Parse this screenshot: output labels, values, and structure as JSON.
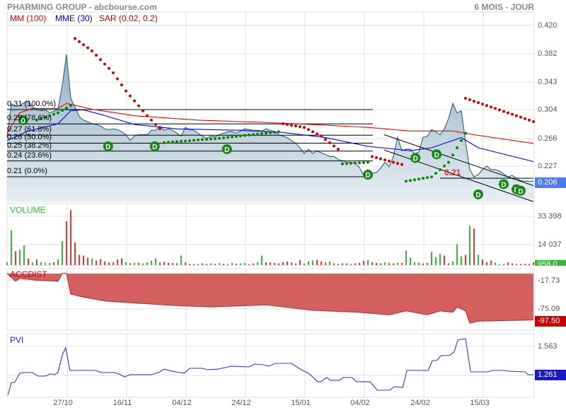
{
  "header": {
    "title": "PHARMING GROUP - abcbourse.com",
    "period": "6 MOIS - JOUR"
  },
  "legend": {
    "mm": "MM (100)",
    "mme": "MME (30)",
    "sar": "SAR (0.02, 0.2)"
  },
  "colors": {
    "mm": "#ee0000",
    "mme": "#0000ee",
    "sar_down": "#cc0000",
    "sar_up": "#008800",
    "area_stroke": "#3d6a80",
    "vol_up": "#33bb33",
    "vol_down": "#ee3333",
    "accdist": "#d66060",
    "pvi": "#3333cc",
    "last_price_badge": "#4a7cf5",
    "vol_badge": "#33bb33",
    "accdist_badge": "#cc0000",
    "pvi_badge": "#1a1acc"
  },
  "chart_data": [
    {
      "type": "line",
      "name": "price",
      "title": "PHARMING GROUP",
      "x_unit": "trading day index",
      "ylim": [
        0.185,
        0.43
      ],
      "y_ticks": [
        "0.420",
        "0.382",
        "0.343",
        "0.304",
        "0.266",
        "0.227"
      ],
      "x_ticks": [
        "27/10",
        "16/11",
        "04/12",
        "24/12",
        "15/01",
        "04/02",
        "24/02",
        "15/03"
      ],
      "last_value": "0.206",
      "close": [
        0.266,
        0.312,
        0.309,
        0.31,
        0.314,
        0.316,
        0.308,
        0.305,
        0.303,
        0.304,
        0.3,
        0.302,
        0.305,
        0.338,
        0.38,
        0.32,
        0.308,
        0.295,
        0.29,
        0.288,
        0.285,
        0.284,
        0.282,
        0.278,
        0.277,
        0.278,
        0.277,
        0.274,
        0.27,
        0.262,
        0.268,
        0.27,
        0.27,
        0.27,
        0.276,
        0.276,
        0.282,
        0.276,
        0.278,
        0.276,
        0.272,
        0.268,
        0.28,
        0.277,
        0.276,
        0.272,
        0.268,
        0.265,
        0.268,
        0.267,
        0.27,
        0.272,
        0.274,
        0.274,
        0.272,
        0.275,
        0.278,
        0.277,
        0.276,
        0.276,
        0.275,
        0.278,
        0.276,
        0.274,
        0.27,
        0.268,
        0.266,
        0.262,
        0.258,
        0.252,
        0.244,
        0.25,
        0.244,
        0.248,
        0.245,
        0.243,
        0.24,
        0.24,
        0.236,
        0.234,
        0.232,
        0.232,
        0.231,
        0.225,
        0.214,
        0.222,
        0.217,
        0.218,
        0.224,
        0.232,
        0.226,
        0.24,
        0.266,
        0.248,
        0.25,
        0.25,
        0.244,
        0.246,
        0.266,
        0.268,
        0.277,
        0.274,
        0.27,
        0.278,
        0.292,
        0.313,
        0.3,
        0.303,
        0.26,
        0.222,
        0.212,
        0.215,
        0.222,
        0.227,
        0.222,
        0.222,
        0.22,
        0.216,
        0.212,
        0.214,
        0.21,
        0.207,
        0.206,
        0.206,
        0.206
      ],
      "mm100": [
        [
          0,
          0.272
        ],
        [
          3,
          0.3
        ],
        [
          6,
          0.306
        ],
        [
          12,
          0.306
        ],
        [
          14,
          0.313
        ],
        [
          20,
          0.305
        ],
        [
          30,
          0.296
        ],
        [
          45,
          0.29
        ],
        [
          60,
          0.287
        ],
        [
          75,
          0.283
        ],
        [
          85,
          0.28
        ],
        [
          95,
          0.275
        ],
        [
          105,
          0.275
        ],
        [
          110,
          0.27
        ],
        [
          124,
          0.258
        ]
      ],
      "mme30": [
        [
          0,
          0.262
        ],
        [
          5,
          0.275
        ],
        [
          12,
          0.285
        ],
        [
          15,
          0.303
        ],
        [
          18,
          0.304
        ],
        [
          22,
          0.298
        ],
        [
          30,
          0.284
        ],
        [
          40,
          0.278
        ],
        [
          55,
          0.276
        ],
        [
          65,
          0.273
        ],
        [
          75,
          0.266
        ],
        [
          85,
          0.254
        ],
        [
          95,
          0.248
        ],
        [
          100,
          0.252
        ],
        [
          107,
          0.266
        ],
        [
          111,
          0.252
        ],
        [
          124,
          0.233
        ]
      ],
      "sar": [
        {
          "trend": "down",
          "points": [
            [
              16,
              0.402
            ],
            [
              20,
              0.385
            ],
            [
              25,
              0.355
            ],
            [
              28,
              0.33
            ],
            [
              33,
              0.296
            ],
            [
              36,
              0.278
            ]
          ]
        },
        {
          "trend": "up",
          "points": [
            [
              7,
              0.29
            ],
            [
              12,
              0.3
            ],
            [
              15,
              0.31
            ]
          ]
        },
        {
          "trend": "up",
          "points": [
            [
              37,
              0.259
            ],
            [
              50,
              0.265
            ],
            [
              64,
              0.274
            ]
          ]
        },
        {
          "trend": "down",
          "points": [
            [
              65,
              0.285
            ],
            [
              70,
              0.28
            ],
            [
              74,
              0.268
            ],
            [
              78,
              0.25
            ]
          ]
        },
        {
          "trend": "up",
          "points": [
            [
              79,
              0.23
            ],
            [
              85,
              0.232
            ]
          ]
        },
        {
          "trend": "down",
          "points": [
            [
              86,
              0.24
            ],
            [
              93,
              0.229
            ]
          ]
        },
        {
          "trend": "up",
          "points": [
            [
              94,
              0.206
            ],
            [
              100,
              0.212
            ],
            [
              104,
              0.232
            ],
            [
              108,
              0.272
            ]
          ]
        },
        {
          "trend": "down",
          "points": [
            [
              108,
              0.32
            ],
            [
              124,
              0.288
            ]
          ]
        }
      ],
      "fibonacci": {
        "high": 0.3045,
        "low": 0.2122,
        "levels": [
          {
            "pct": 1.0,
            "label": "0.31  (100.0%)"
          },
          {
            "pct": 0.786,
            "label": "0.29  (78.6%)"
          },
          {
            "pct": 0.618,
            "label": "0.27  (61.8%)"
          },
          {
            "pct": 0.5,
            "label": "0.26  (50.0%)"
          },
          {
            "pct": 0.382,
            "label": "0.25  (38.2%)"
          },
          {
            "pct": 0.236,
            "label": "0.24  (23.6%)"
          },
          {
            "pct": 0.0,
            "label": "0.21  (0.0%)"
          }
        ]
      },
      "markers": {
        "label": "D",
        "points": [
          [
            3.8,
            0.29
          ],
          [
            23.8,
            0.254
          ],
          [
            34.8,
            0.254
          ],
          [
            51.8,
            0.25
          ],
          [
            85,
            0.215
          ],
          [
            96.2,
            0.238
          ],
          [
            101.2,
            0.243
          ],
          [
            111,
            0.188
          ],
          [
            117,
            0.202
          ],
          [
            120,
            0.195
          ],
          [
            121,
            0.193
          ]
        ]
      },
      "channel": [
        [
          [
            88.8,
            0.27
          ],
          [
            124,
            0.2
          ]
        ],
        [
          [
            88.8,
            0.249
          ],
          [
            124,
            0.178
          ]
        ]
      ],
      "support": {
        "value": 0.2102,
        "label": "0.21",
        "from": 102,
        "to": 124
      }
    },
    {
      "type": "bar",
      "name": "volume",
      "title": "VOLUME",
      "y_ticks": [
        "33 398",
        "14 037"
      ],
      "last_value": "958.0",
      "values": [
        2000,
        23700,
        9500,
        10500,
        13500,
        4500,
        1800,
        3800,
        2000,
        1500,
        1500,
        2000,
        3800,
        16400,
        30000,
        37700,
        15500,
        7000,
        6500,
        5000,
        4500,
        3200,
        4200,
        2500,
        1800,
        1800,
        3800,
        4500,
        2000,
        1500,
        1800,
        1500,
        1200,
        2000,
        3000,
        4500,
        1800,
        2200,
        1500,
        1500,
        1300,
        6500,
        1800,
        800,
        800,
        800,
        1200,
        800,
        1200,
        800,
        1500,
        800,
        800,
        1500,
        1000,
        1200,
        1500,
        600,
        1200,
        1800,
        6500,
        2000,
        1800,
        1500,
        1200,
        2000,
        2500,
        1800,
        1200,
        3500,
        1200,
        2500,
        3200,
        3500,
        2500,
        1800,
        2500,
        1200,
        800,
        1200,
        1200,
        800,
        1200,
        1500,
        3000,
        3500,
        2000,
        1500,
        1200,
        2000,
        1500,
        1200,
        1800,
        1500,
        10000,
        5000,
        2000,
        1800,
        1200,
        1500,
        9000,
        5500,
        7800,
        6500,
        1200,
        2500,
        14300,
        6000,
        7000,
        27000,
        25000,
        7000,
        3800,
        2000,
        3200,
        1800,
        800,
        800,
        1800,
        1200,
        800,
        800,
        800,
        900,
        2000
      ],
      "direction": "ggrggrgrgggrggrrrrrrgrrrrrrrgggrggggrrrrrgrrrgrrgrgrggrggrrggrrrrrrrrrgggrrrgrrrrgrrrgrrrgrrgrggggrrgggrrgggrgrgrrrgggrrrrrrrrr"
    },
    {
      "type": "area",
      "name": "accdist",
      "title": "ACCDIST",
      "y_ticks": [
        "-17.73",
        "-75.09"
      ],
      "last_value": "-97.50",
      "points": [
        [
          0,
          -3
        ],
        [
          2,
          -19
        ],
        [
          3,
          -13
        ],
        [
          7,
          -17
        ],
        [
          12,
          -19
        ],
        [
          13,
          -3
        ],
        [
          14,
          -3
        ],
        [
          15,
          -45
        ],
        [
          18,
          -51
        ],
        [
          23,
          -59
        ],
        [
          28,
          -62
        ],
        [
          39,
          -68
        ],
        [
          48,
          -71
        ],
        [
          61,
          -67
        ],
        [
          72,
          -78
        ],
        [
          83,
          -82
        ],
        [
          90,
          -87
        ],
        [
          94,
          -79
        ],
        [
          99,
          -87
        ],
        [
          102,
          -79
        ],
        [
          105,
          -82
        ],
        [
          106,
          -71
        ],
        [
          108,
          -79
        ],
        [
          109,
          -104
        ],
        [
          111,
          -100
        ],
        [
          124,
          -97.5
        ]
      ]
    },
    {
      "type": "line",
      "name": "pvi",
      "title": "PVI",
      "y_ticks": [
        "1.563"
      ],
      "last_value": "1.261",
      "points": [
        [
          0.2,
          1.042
        ],
        [
          1,
          1.178
        ],
        [
          1.8,
          1.178
        ],
        [
          3,
          1.276
        ],
        [
          4.3,
          1.284
        ],
        [
          6,
          1.284
        ],
        [
          7.3,
          1.246
        ],
        [
          9,
          1.246
        ],
        [
          10.2,
          1.269
        ],
        [
          11.2,
          1.261
        ],
        [
          12,
          1.284
        ],
        [
          13,
          1.472
        ],
        [
          13.8,
          1.548
        ],
        [
          14.8,
          1.306
        ],
        [
          20.8,
          1.306
        ],
        [
          22.2,
          1.284
        ],
        [
          25.2,
          1.284
        ],
        [
          26.3,
          1.269
        ],
        [
          27.7,
          1.238
        ],
        [
          29,
          1.261
        ],
        [
          34,
          1.261
        ],
        [
          35.7,
          1.284
        ],
        [
          37,
          1.321
        ],
        [
          38.7,
          1.299
        ],
        [
          41.7,
          1.276
        ],
        [
          43,
          1.329
        ],
        [
          46,
          1.329
        ],
        [
          47.2,
          1.314
        ],
        [
          49.8,
          1.321
        ],
        [
          52.8,
          1.352
        ],
        [
          57,
          1.344
        ],
        [
          58.3,
          1.374
        ],
        [
          60.3,
          1.367
        ],
        [
          61.7,
          1.352
        ],
        [
          63.2,
          1.382
        ],
        [
          67,
          1.382
        ],
        [
          69.3,
          1.314
        ],
        [
          71,
          1.276
        ],
        [
          73.2,
          1.186
        ],
        [
          74,
          1.186
        ],
        [
          75.3,
          1.231
        ],
        [
          76.2,
          1.201
        ],
        [
          78.3,
          1.201
        ],
        [
          79.2,
          1.231
        ],
        [
          81.2,
          1.231
        ],
        [
          82.3,
          1.186
        ],
        [
          85.5,
          1.186
        ],
        [
          87.2,
          1.095
        ],
        [
          90.2,
          1.095
        ],
        [
          91.2,
          1.133
        ],
        [
          93.2,
          1.125
        ],
        [
          94.2,
          1.306
        ],
        [
          99.2,
          1.306
        ],
        [
          100.2,
          1.412
        ],
        [
          101.2,
          1.412
        ],
        [
          102.2,
          1.465
        ],
        [
          104.2,
          1.465
        ],
        [
          105.3,
          1.503
        ],
        [
          106.2,
          1.631
        ],
        [
          108,
          1.646
        ],
        [
          109.2,
          1.291
        ],
        [
          113.2,
          1.291
        ],
        [
          114.3,
          1.306
        ],
        [
          117,
          1.306
        ],
        [
          118.2,
          1.299
        ],
        [
          122,
          1.291
        ],
        [
          122.8,
          1.261
        ],
        [
          124,
          1.261
        ]
      ]
    }
  ]
}
